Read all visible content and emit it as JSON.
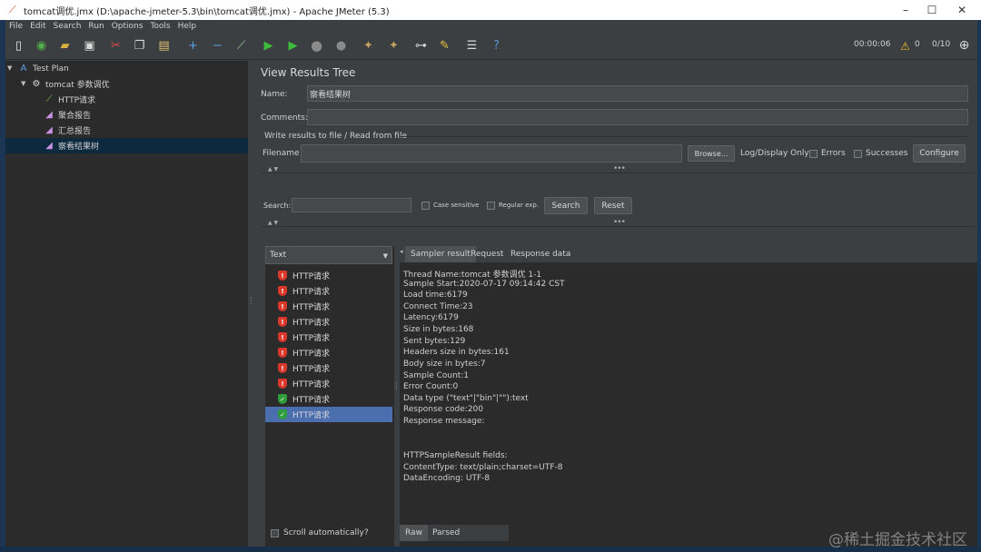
{
  "window": {
    "title": "tomcat调优.jmx (D:\\apache-jmeter-5.3\\bin\\tomcat调优.jmx) - Apache JMeter (5.3)"
  },
  "menu": [
    "File",
    "Edit",
    "Search",
    "Run",
    "Options",
    "Tools",
    "Help"
  ],
  "status": {
    "elapsed": "00:00:06",
    "warnings": "0",
    "threads": "0/10"
  },
  "tree": {
    "test_plan": "Test Plan",
    "thread_group": "tomcat 参数调优",
    "children": [
      "HTTP请求",
      "聚合报告",
      "汇总报告",
      "察看结果树"
    ]
  },
  "panel": {
    "title": "View Results Tree",
    "name_label": "Name:",
    "name_value": "察看结果树",
    "comments_label": "Comments:",
    "comments_value": "",
    "write_results_label": "Write results to file / Read from file",
    "filename_label": "Filename",
    "filename_value": "",
    "browse_label": "Browse...",
    "log_display_label": "Log/Display Only:",
    "errors_label": "Errors",
    "successes_label": "Successes",
    "configure_label": "Configure",
    "search_label": "Search:",
    "search_value": "",
    "case_sensitive_label": "Case sensitive",
    "regular_exp_label": "Regular exp.",
    "search_button": "Search",
    "reset_button": "Reset"
  },
  "results": {
    "renderer": "Text",
    "items": [
      {
        "label": "HTTP请求",
        "status": "fail"
      },
      {
        "label": "HTTP请求",
        "status": "fail"
      },
      {
        "label": "HTTP请求",
        "status": "fail"
      },
      {
        "label": "HTTP请求",
        "status": "fail"
      },
      {
        "label": "HTTP请求",
        "status": "fail"
      },
      {
        "label": "HTTP请求",
        "status": "fail"
      },
      {
        "label": "HTTP请求",
        "status": "fail"
      },
      {
        "label": "HTTP请求",
        "status": "fail"
      },
      {
        "label": "HTTP请求",
        "status": "ok"
      },
      {
        "label": "HTTP请求",
        "status": "ok"
      }
    ],
    "scroll_auto_label": "Scroll automatically?"
  },
  "detail": {
    "tabs": [
      "Sampler result",
      "Request",
      "Response data"
    ],
    "lines": [
      "Thread Name:tomcat 参数调优 1-1",
      "Sample Start:2020-07-17 09:14:42 CST",
      "Load time:6179",
      "Connect Time:23",
      "Latency:6179",
      "Size in bytes:168",
      "Sent bytes:129",
      "Headers size in bytes:161",
      "Body size in bytes:7",
      "Sample Count:1",
      "Error Count:0",
      "Data type (\"text\"|\"bin\"|\"\"):text",
      "Response code:200",
      "Response message:",
      "",
      "",
      "HTTPSampleResult fields:",
      "ContentType: text/plain;charset=UTF-8",
      "DataEncoding: UTF-8"
    ],
    "bottom_tabs": [
      "Raw",
      "Parsed"
    ]
  },
  "watermark": "@稀土掘金技术社区",
  "colors": {
    "panel_bg": "#3c3f41",
    "tree_bg": "#2b2b2b",
    "selection": "#4b6eaf",
    "fail": "#d9382b",
    "ok": "#2e9c3a"
  }
}
